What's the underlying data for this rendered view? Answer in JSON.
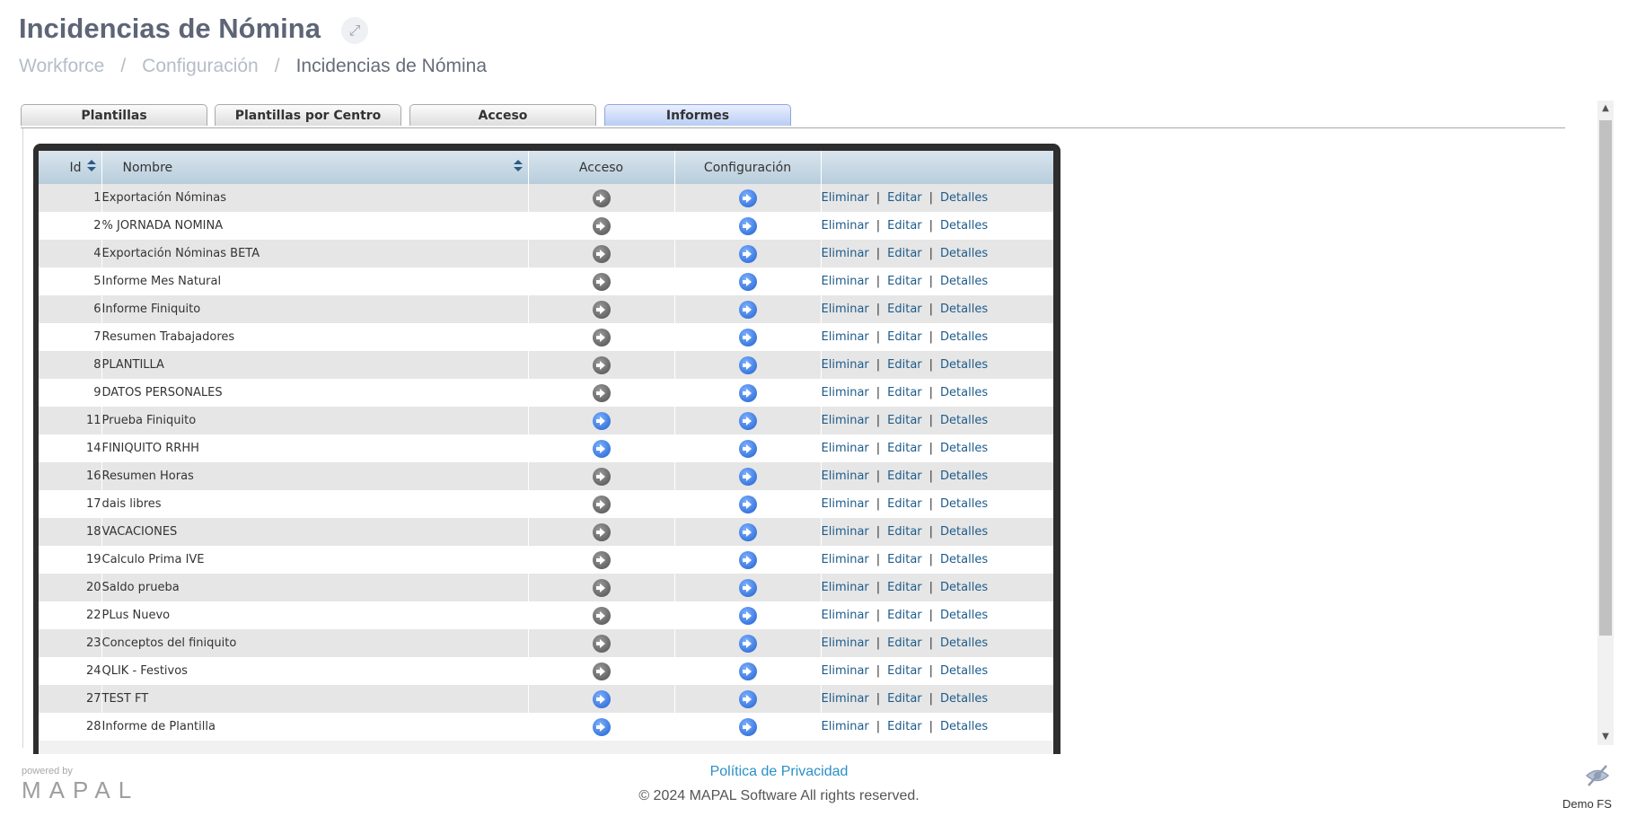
{
  "header": {
    "title": "Incidencias de Nómina",
    "expand_icon": "expand-arrows-icon"
  },
  "breadcrumb": [
    {
      "label": "Workforce"
    },
    {
      "label": "Configuración"
    },
    {
      "label": "Incidencias de Nómina"
    }
  ],
  "tabs": [
    {
      "label": "Plantillas",
      "active": false
    },
    {
      "label": "Plantillas por Centro",
      "active": false
    },
    {
      "label": "Acceso",
      "active": false
    },
    {
      "label": "Informes",
      "active": true
    }
  ],
  "grid": {
    "columns": [
      "Id",
      "Nombre",
      "Acceso",
      "Configuración",
      ""
    ],
    "actions": {
      "delete": "Eliminar",
      "edit": "Editar",
      "details": "Detalles",
      "separator": "|"
    },
    "rows": [
      {
        "id": "1",
        "name": "Exportación Nóminas",
        "acceso": "grey",
        "config": "blue"
      },
      {
        "id": "2",
        "name": "% JORNADA NOMINA",
        "acceso": "grey",
        "config": "blue"
      },
      {
        "id": "4",
        "name": "Exportación Nóminas BETA",
        "acceso": "grey",
        "config": "blue"
      },
      {
        "id": "5",
        "name": "Informe Mes Natural",
        "acceso": "grey",
        "config": "blue"
      },
      {
        "id": "6",
        "name": "Informe Finiquito",
        "acceso": "grey",
        "config": "blue"
      },
      {
        "id": "7",
        "name": "Resumen Trabajadores",
        "acceso": "grey",
        "config": "blue"
      },
      {
        "id": "8",
        "name": "PLANTILLA",
        "acceso": "grey",
        "config": "blue"
      },
      {
        "id": "9",
        "name": "DATOS PERSONALES",
        "acceso": "grey",
        "config": "blue"
      },
      {
        "id": "11",
        "name": "Prueba Finiquito",
        "acceso": "blue",
        "config": "blue"
      },
      {
        "id": "14",
        "name": "FINIQUITO RRHH",
        "acceso": "blue",
        "config": "blue"
      },
      {
        "id": "16",
        "name": "Resumen Horas",
        "acceso": "grey",
        "config": "blue"
      },
      {
        "id": "17",
        "name": "dais libres",
        "acceso": "grey",
        "config": "blue"
      },
      {
        "id": "18",
        "name": "VACACIONES",
        "acceso": "grey",
        "config": "blue"
      },
      {
        "id": "19",
        "name": "Calculo Prima IVE",
        "acceso": "grey",
        "config": "blue"
      },
      {
        "id": "20",
        "name": "Saldo prueba",
        "acceso": "grey",
        "config": "blue"
      },
      {
        "id": "22",
        "name": "PLus Nuevo",
        "acceso": "grey",
        "config": "blue"
      },
      {
        "id": "23",
        "name": "Conceptos del finiquito",
        "acceso": "grey",
        "config": "blue"
      },
      {
        "id": "24",
        "name": "QLIK - Festivos",
        "acceso": "grey",
        "config": "blue"
      },
      {
        "id": "27",
        "name": "TEST FT",
        "acceso": "blue",
        "config": "blue"
      },
      {
        "id": "28",
        "name": "Informe de Plantilla",
        "acceso": "blue",
        "config": "blue"
      }
    ]
  },
  "footer": {
    "powered_by": "powered by",
    "logo": "MAPAL",
    "privacy_link": "Política de Privacidad",
    "copyright": "© 2024 MAPAL Software All rights reserved.",
    "user_label": "Demo FS",
    "user_icon": "eye-slash-icon"
  },
  "colors": {
    "title": "#5d6577",
    "link": "#1d5b8a",
    "footer_link": "#2a8fc8",
    "active_tab": "#b9cdf3",
    "grid_header": "#c5d7e4"
  }
}
